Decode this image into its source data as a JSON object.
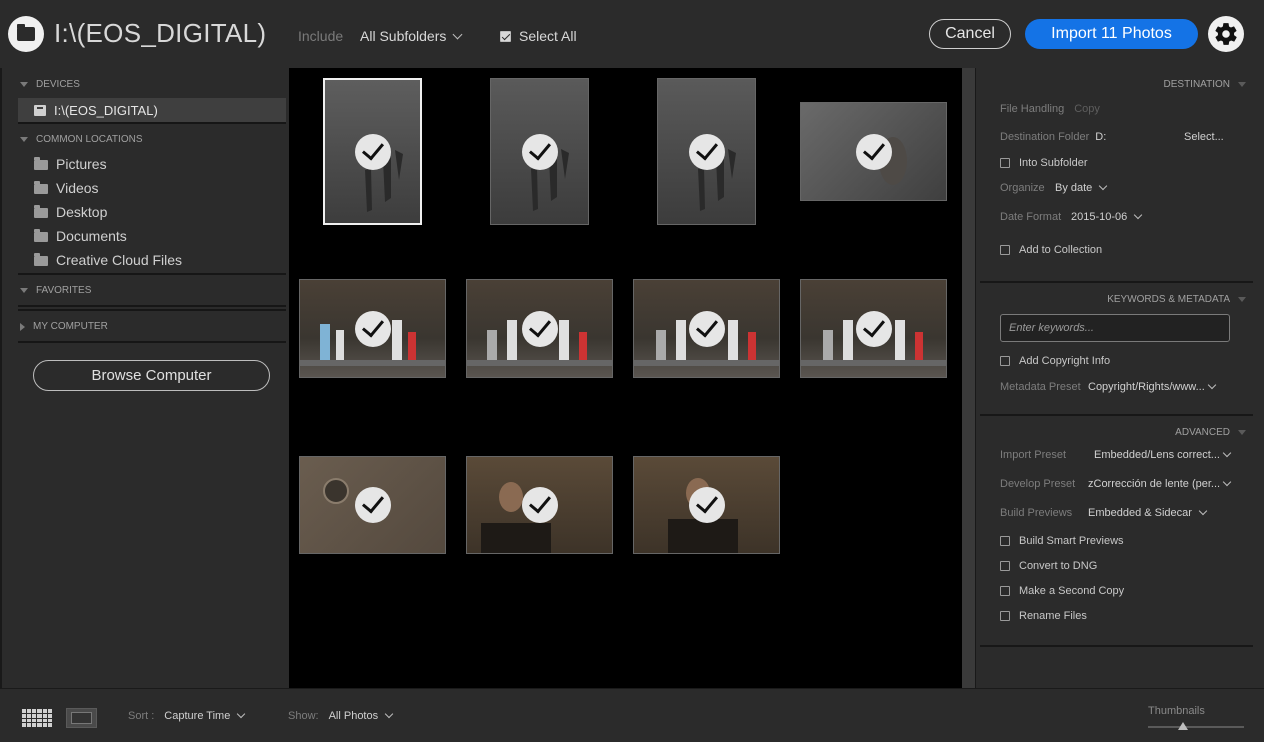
{
  "header": {
    "source_title": "I:\\(EOS_DIGITAL)",
    "include_label": "Include",
    "include_value": "All Subfolders",
    "select_all_label": "Select All",
    "cancel_label": "Cancel",
    "import_label": "Import 11 Photos"
  },
  "sidebar": {
    "devices_header": "DEVICES",
    "device_name": "I:\\(EOS_DIGITAL)",
    "common_header": "COMMON LOCATIONS",
    "locations": [
      "Pictures",
      "Videos",
      "Desktop",
      "Documents",
      "Creative Cloud Files"
    ],
    "favorites_header": "FAVORITES",
    "my_computer_header": "MY COMPUTER",
    "browse_label": "Browse Computer"
  },
  "grid": {
    "photos": [
      {
        "scene": "tap",
        "checked": true,
        "selected": true,
        "orientation": "portrait"
      },
      {
        "scene": "tap",
        "checked": true,
        "selected": false,
        "orientation": "portrait"
      },
      {
        "scene": "tap",
        "checked": true,
        "selected": false,
        "orientation": "portrait"
      },
      {
        "scene": "hand",
        "checked": true,
        "selected": false,
        "orientation": "landscape"
      },
      {
        "scene": "shelf",
        "checked": true,
        "selected": false,
        "orientation": "landscape"
      },
      {
        "scene": "shelf",
        "checked": true,
        "selected": false,
        "orientation": "landscape"
      },
      {
        "scene": "shelf",
        "checked": true,
        "selected": false,
        "orientation": "landscape"
      },
      {
        "scene": "shelf",
        "checked": true,
        "selected": false,
        "orientation": "landscape"
      },
      {
        "scene": "drain",
        "checked": true,
        "selected": false,
        "orientation": "landscape"
      },
      {
        "scene": "person",
        "checked": true,
        "selected": false,
        "orientation": "landscape"
      },
      {
        "scene": "person",
        "checked": true,
        "selected": false,
        "orientation": "landscape"
      }
    ]
  },
  "destination": {
    "header": "DESTINATION",
    "file_handling_label": "File Handling",
    "file_handling_value": "Copy",
    "dest_folder_label": "Destination Folder",
    "dest_folder_value": "D:",
    "select_label": "Select...",
    "into_subfolder_label": "Into Subfolder",
    "organize_label": "Organize",
    "organize_value": "By date",
    "date_format_label": "Date Format",
    "date_format_value": "2015-10-06",
    "add_collection_label": "Add to Collection"
  },
  "keywords": {
    "header": "KEYWORDS & METADATA",
    "placeholder": "Enter keywords...",
    "copyright_label": "Add Copyright Info",
    "metadata_preset_label": "Metadata Preset",
    "metadata_preset_value": "Copyright/Rights/www..."
  },
  "advanced": {
    "header": "ADVANCED",
    "import_preset_label": "Import Preset",
    "import_preset_value": "Embedded/Lens correct...",
    "develop_preset_label": "Develop Preset",
    "develop_preset_value": "zCorrección de lente (per...",
    "build_previews_label": "Build Previews",
    "build_previews_value": "Embedded & Sidecar",
    "smart_previews_label": "Build Smart Previews",
    "dng_label": "Convert to DNG",
    "second_copy_label": "Make a Second Copy",
    "rename_label": "Rename Files"
  },
  "footer": {
    "sort_label": "Sort :",
    "sort_value": "Capture Time",
    "show_label": "Show:",
    "show_value": "All Photos",
    "thumbnails_label": "Thumbnails",
    "thumbnail_size": 0.35
  }
}
